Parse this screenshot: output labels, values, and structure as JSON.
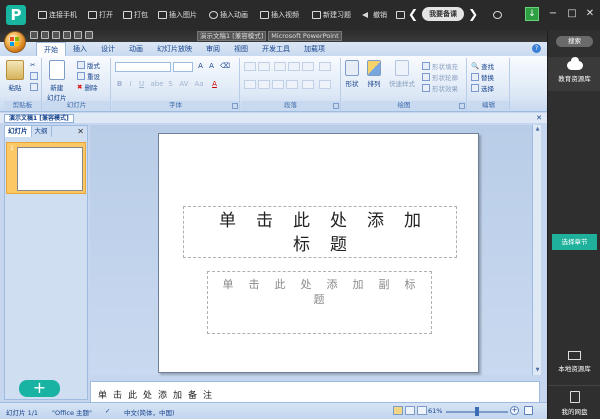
{
  "topbar": {
    "logo": "P",
    "buttons": [
      "连接手机",
      "打开",
      "打包",
      "插入图片",
      "插入动画",
      "插入视频",
      "新建习题",
      "撤销"
    ],
    "course_button": "我要备课",
    "prev": "❮",
    "next": "❯"
  },
  "office": {
    "doc_title": "演示文稿1 [兼容模式]",
    "app_name": "Microsoft PowerPoint",
    "tabs": [
      "开始",
      "插入",
      "设计",
      "动画",
      "幻灯片放映",
      "审阅",
      "视图",
      "开发工具",
      "加载项"
    ],
    "help": "?",
    "ribbon": {
      "groups": [
        "剪贴板",
        "幻灯片",
        "字体",
        "段落",
        "绘图",
        "编辑"
      ],
      "paste": "粘贴",
      "new_slide": "新建\n幻灯片",
      "layout": "版式",
      "reset": "重设",
      "delete": "删除",
      "shape": "形状",
      "arrange": "排列",
      "quick_style": "快速样式",
      "shape_fill": "形状填充",
      "shape_outline": "形状轮廓",
      "shape_effect": "形状效果",
      "find": "查找",
      "replace": "替换",
      "select": "选择",
      "font_buttons": [
        "B",
        "I",
        "U",
        "abe",
        "S",
        "AV",
        "Aa",
        "A"
      ]
    },
    "doc_tab": "演示文稿1 [兼容模式]",
    "left_tabs": [
      "幻灯片",
      "大纲"
    ],
    "slide_number": "1",
    "slide": {
      "title": "单击此处添加标题",
      "subtitle": "单击此处添加副标题"
    },
    "notes": "单击此处添加备注",
    "status": {
      "slide": "幻灯片 1/1",
      "theme": "\"Office 主题\"",
      "lang": "中文(简体，中国)",
      "zoom": "61%"
    }
  },
  "right_panel": {
    "search": "搜索",
    "resource_lib": "教育资源库",
    "select_chapter": "选择章节",
    "local_lib": "本地资源库",
    "my_disk": "我的网盘"
  },
  "add_button": "+",
  "colors": {
    "teal": "#19b3a3",
    "topbar": "#2a2a2a",
    "office_blue": "#c5d6ee"
  }
}
